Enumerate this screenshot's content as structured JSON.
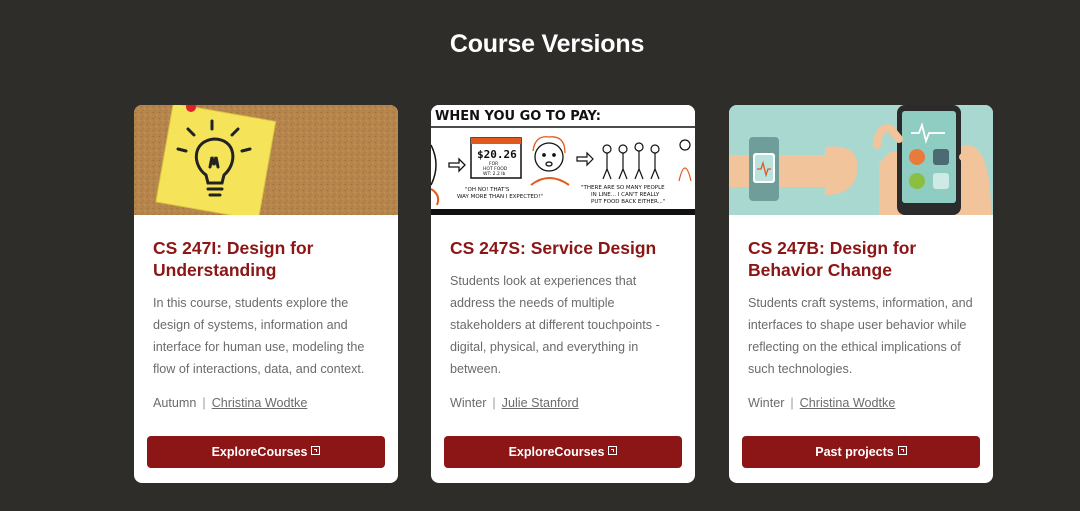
{
  "section_title": "Course Versions",
  "colors": {
    "background": "#2e2d29",
    "accent": "#8c1515",
    "card": "#ffffff"
  },
  "cards": [
    {
      "image_icon": "lightbulb-sticky-note-image",
      "title": "CS 247I: Design for Understanding",
      "description": "In this course, students explore the design of systems, information and interface for human use, modeling the flow of interactions, data, and context.",
      "term": "Autumn",
      "instructor": "Christina Wodtke",
      "button_label": "ExploreCourses"
    },
    {
      "image_icon": "sketch-comic-image",
      "image_text": {
        "headline": "WHEN YOU GO TO PAY:",
        "price": "$20.26",
        "line1": "FOR",
        "line2": "HOT FOOD",
        "line3": "WT: 2.2 lb",
        "quote1a": "\"OH NO! THAT'S",
        "quote1b": "WAY MORE THAN I EXPECTED!\"",
        "quote2a": "\"THERE ARE SO MANY PEOPLE",
        "quote2b": "IN LINE... I CAN'T REALLY",
        "quote2c": "PUT FOOD BACK EITHER...\""
      },
      "title": "CS 247S: Service Design",
      "description": "Students look at experiences that address the needs of multiple stakeholders at different touchpoints - digital, physical, and everything in between.",
      "term": "Winter",
      "instructor": "Julie Stanford",
      "button_label": "ExploreCourses"
    },
    {
      "image_icon": "smartwatch-phone-image",
      "title": "CS 247B: Design for Behavior Change",
      "description": "Students craft systems, information, and interfaces to shape user behavior while reflecting on the ethical implications of such technologies.",
      "term": "Winter",
      "instructor": "Christina Wodtke",
      "button_label": "Past projects"
    }
  ]
}
